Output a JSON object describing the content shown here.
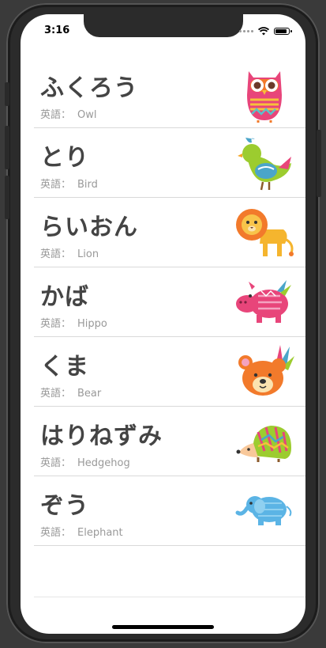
{
  "status": {
    "time": "3:16"
  },
  "english_label": "英語：",
  "animals": [
    {
      "name": "ふくろう",
      "english": "Owl",
      "icon": "owl-icon"
    },
    {
      "name": "とり",
      "english": "Bird",
      "icon": "bird-icon"
    },
    {
      "name": "らいおん",
      "english": "Lion",
      "icon": "lion-icon"
    },
    {
      "name": "かば",
      "english": "Hippo",
      "icon": "hippo-icon"
    },
    {
      "name": "くま",
      "english": "Bear",
      "icon": "bear-icon"
    },
    {
      "name": "はりねずみ",
      "english": "Hedgehog",
      "icon": "hedgehog-icon"
    },
    {
      "name": "ぞう",
      "english": "Elephant",
      "icon": "elephant-icon"
    }
  ]
}
